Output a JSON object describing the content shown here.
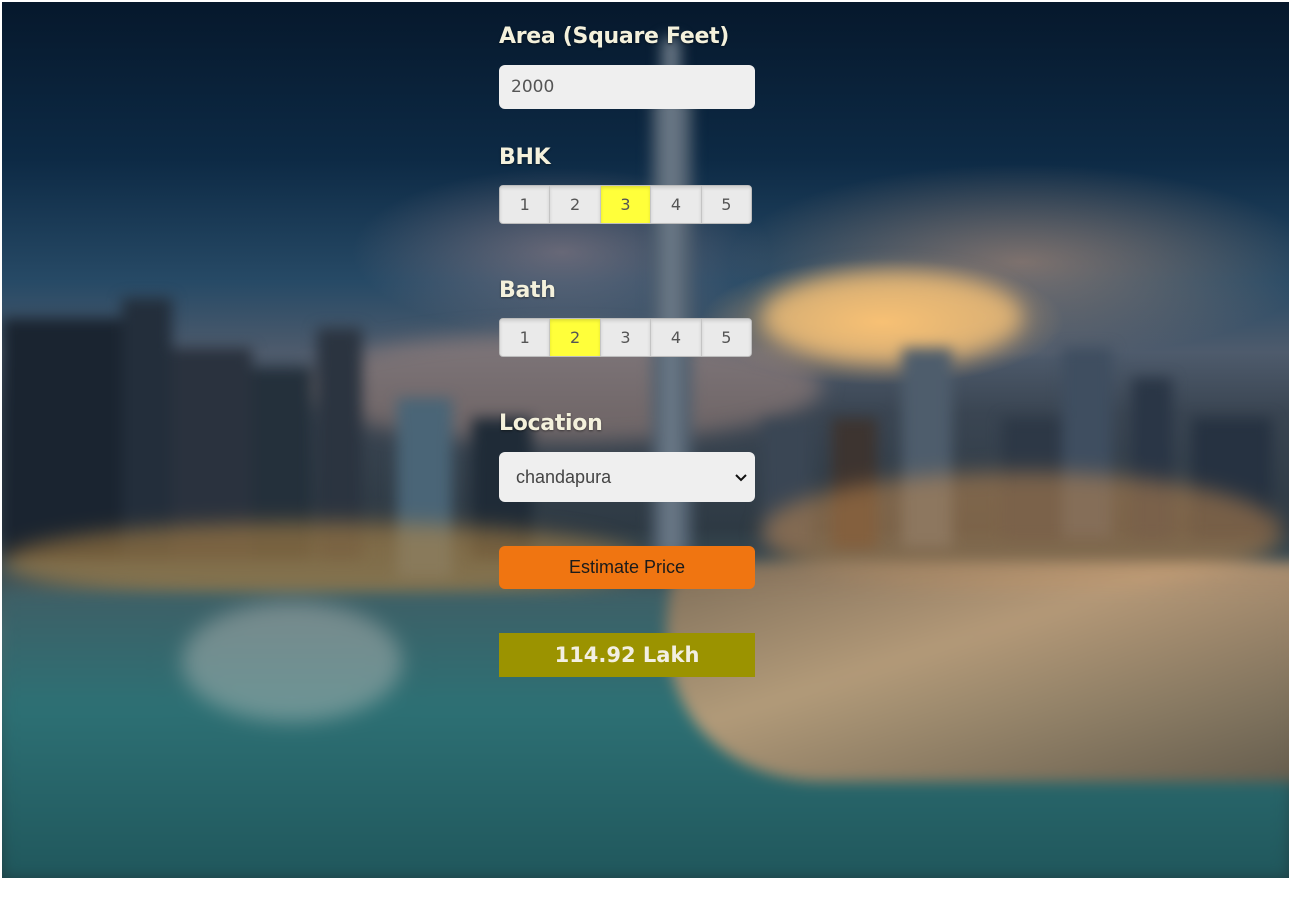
{
  "form": {
    "area": {
      "label": "Area (Square Feet)",
      "value": "2000"
    },
    "bhk": {
      "label": "BHK",
      "options": [
        "1",
        "2",
        "3",
        "4",
        "5"
      ],
      "selected": "3"
    },
    "bath": {
      "label": "Bath",
      "options": [
        "1",
        "2",
        "3",
        "4",
        "5"
      ],
      "selected": "2"
    },
    "location": {
      "label": "Location",
      "selected": "chandapura"
    },
    "estimate_button": "Estimate Price",
    "result": "114.92 Lakh"
  },
  "colors": {
    "selected_option": "#ffff3a",
    "button": "#f07511",
    "result_bg": "#9b9300"
  },
  "icons": {
    "select_arrow": "chevron-down-icon"
  }
}
